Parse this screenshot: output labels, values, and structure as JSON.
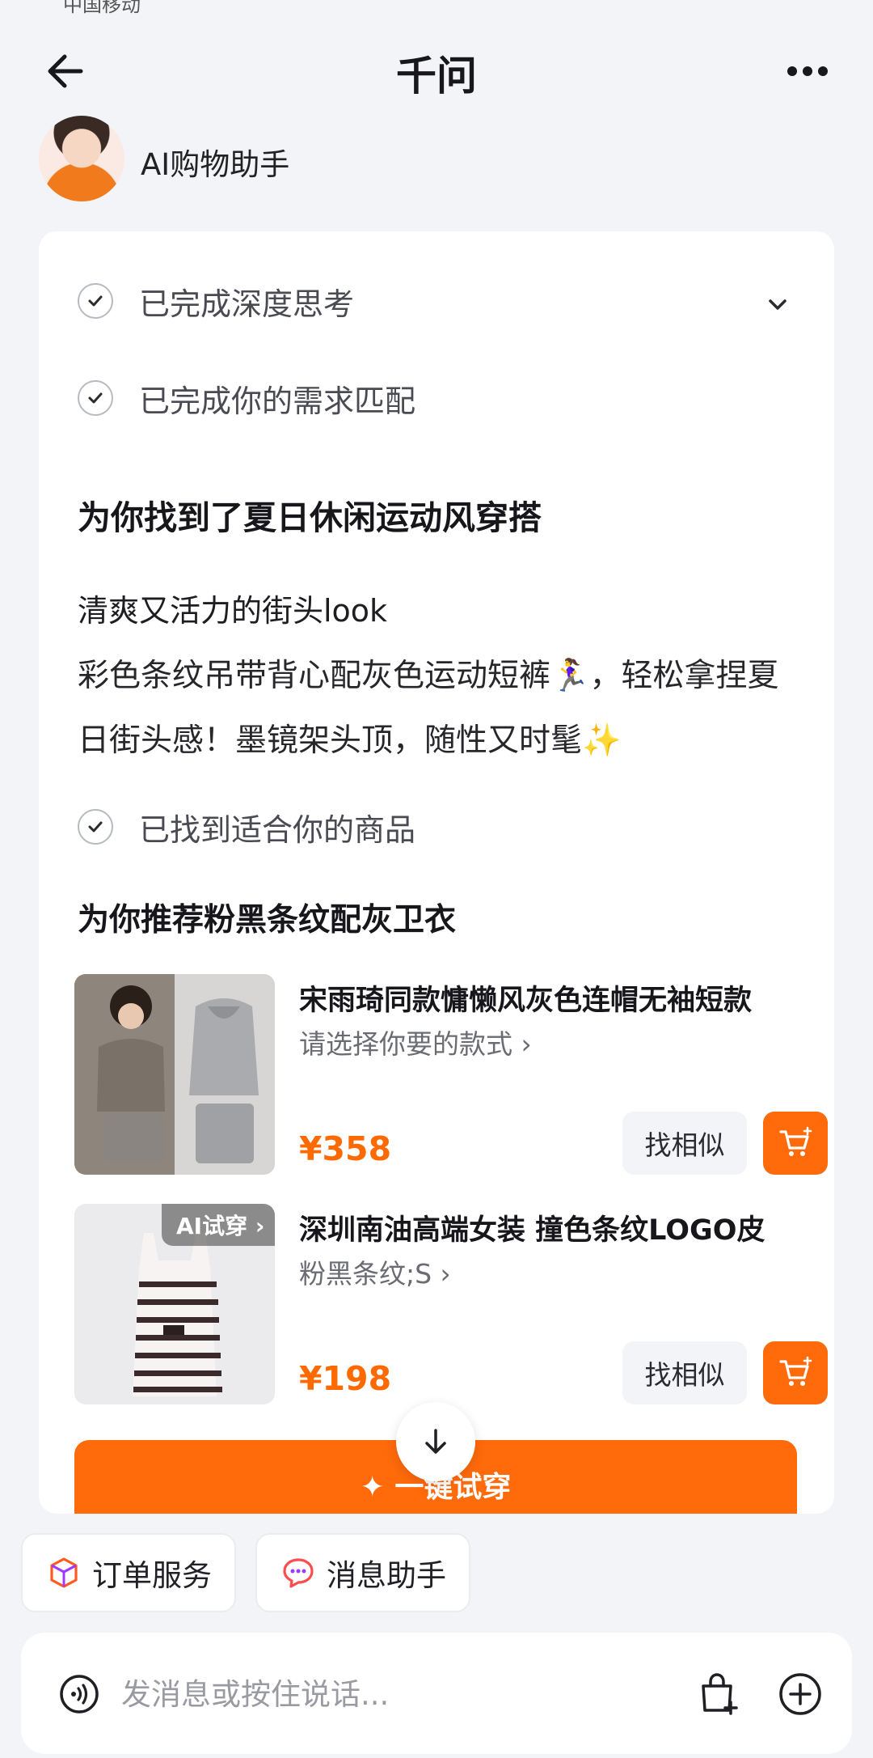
{
  "status_bar": {
    "carrier": "中国移动"
  },
  "header": {
    "title": "千问"
  },
  "assistant": {
    "name": "AI购物助手"
  },
  "steps": {
    "thinking": "已完成深度思考",
    "matching": "已完成你的需求匹配",
    "found": "已找到适合你的商品"
  },
  "content": {
    "heading": "为你找到了夏日休闲运动风穿搭",
    "subheading": "清爽又活力的街头look",
    "paragraph": "彩色条纹吊带背心配灰色运动短裤🏃‍♀️，轻松拿捏夏日街头感！墨镜架头顶，随性又时髦✨",
    "recommend_heading": "为你推荐粉黑条纹配灰卫衣"
  },
  "products": [
    {
      "title": "宋雨琦同款慵懒风灰色连帽无袖短款",
      "variant": "请选择你要的款式 ›",
      "price": "¥358",
      "similar": "找相似"
    },
    {
      "title": "深圳南油高端女装 撞色条纹LOGO皮",
      "variant": "粉黑条纹;S ›",
      "price": "¥198",
      "similar": "找相似",
      "badge": "AI试穿 ›"
    }
  ],
  "actions": {
    "try_on": "✦  一键试穿"
  },
  "chips": [
    {
      "label": "订单服务"
    },
    {
      "label": "消息助手"
    }
  ],
  "input": {
    "placeholder": "发消息或按住说话..."
  },
  "colors": {
    "accent": "#ff6a0a",
    "price": "#ff6a00",
    "background": "#f3f4f8"
  },
  "icons": [
    "back-arrow-icon",
    "more-icon",
    "check-icon",
    "chevron-down-icon",
    "cart-plus-icon",
    "arrow-down-icon",
    "order-box-icon",
    "message-icon",
    "voice-icon",
    "shopping-bag-icon",
    "plus-circle-icon"
  ]
}
